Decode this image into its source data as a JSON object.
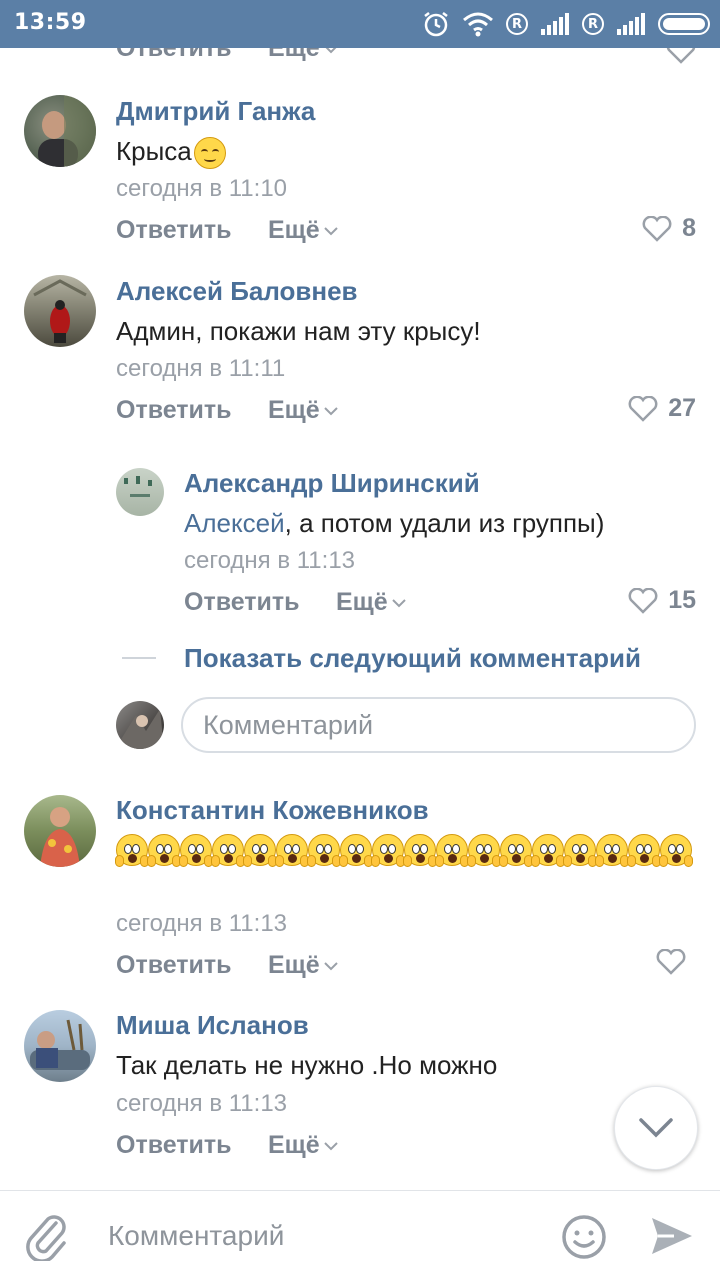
{
  "status_bar": {
    "time": "13:59",
    "roaming_badge": "R"
  },
  "comments": [
    {
      "author": "Дмитрий Ганжа",
      "text": "Крыса",
      "date": "сегодня в 11:10",
      "reply": "Ответить",
      "more": "Ещё",
      "likes": "8"
    },
    {
      "author": "Алексей Баловнев",
      "text": "Админ, покажи нам эту крысу!",
      "date": "сегодня в 11:11",
      "reply": "Ответить",
      "more": "Ещё",
      "likes": "27"
    },
    {
      "author": "Александр Ширинский",
      "mention": "Алексей",
      "text": ", а потом удали из группы)",
      "date": "сегодня в 11:13",
      "reply": "Ответить",
      "more": "Ещё",
      "likes": "15"
    },
    {
      "author": "Константин Кожевников",
      "date": "сегодня в 11:13",
      "reply": "Ответить",
      "more": "Ещё",
      "likes": ""
    },
    {
      "author": "Миша Исланов",
      "text": "Так делать не нужно .Но можно",
      "date": "сегодня в 11:13",
      "reply": "Ответить",
      "more": "Ещё",
      "likes": ""
    }
  ],
  "top_partial": {
    "reply": "Ответить",
    "more": "Ещё"
  },
  "show_next": "Показать следующий комментарий",
  "inline_comment_placeholder": "Комментарий",
  "bottom_bar": {
    "placeholder": "Комментарий"
  },
  "colors": {
    "status_bar": "#5b7fa6",
    "link": "#4a6f98",
    "meta": "#7c8591"
  }
}
